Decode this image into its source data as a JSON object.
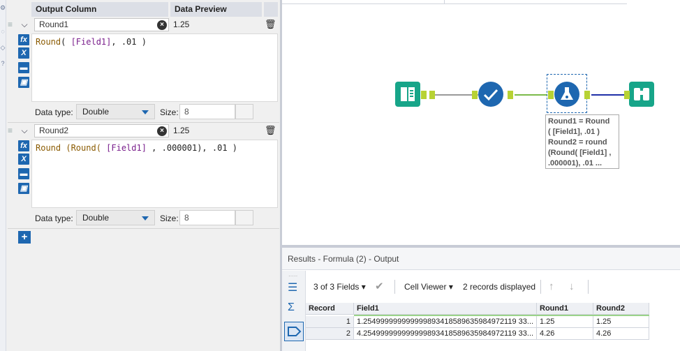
{
  "config": {
    "headers": {
      "output_column": "Output Column",
      "data_preview": "Data Preview"
    },
    "formulas": [
      {
        "name": "Round1",
        "preview": "1.25",
        "expression": {
          "fn": "Round",
          "open": "( ",
          "field": "[Field1]",
          "rest": ", .01 )"
        },
        "data_type_label": "Data type:",
        "data_type": "Double",
        "size_label": "Size:",
        "size": "8"
      },
      {
        "name": "Round2",
        "preview": "1.25",
        "expression": {
          "fn": "Round",
          "open": " (Round( ",
          "field": "[Field1]",
          "rest": " , .000001), .01 )"
        },
        "data_type_label": "Data type:",
        "data_type": "Double",
        "size_label": "Size:",
        "size": "8"
      }
    ],
    "add_label": "+"
  },
  "canvas": {
    "annotation": [
      "Round1 = Round",
      "( [Field1], .01 )",
      "Round2 = round",
      "(Round( [Field1] ,",
      ".000001), .01 ..."
    ],
    "tools": [
      {
        "name": "input",
        "color": "#17a589"
      },
      {
        "name": "select",
        "color": "#1e67b0"
      },
      {
        "name": "formula",
        "color": "#1e67b0"
      },
      {
        "name": "browse",
        "color": "#17a589"
      }
    ]
  },
  "results": {
    "title": "Results - Formula (2) - Output",
    "fields_label": "3 of 3 Fields",
    "cell_viewer_label": "Cell Viewer",
    "records_label": "2 records displayed",
    "columns": [
      "Record",
      "Field1",
      "Round1",
      "Round2"
    ],
    "rows": [
      [
        "1",
        "1.254999999999999893418589635984972119 33...",
        "1.25",
        "1.25"
      ],
      [
        "2",
        "4.254999999999999893418589635984972119 33...",
        "4.26",
        "4.26"
      ]
    ]
  }
}
